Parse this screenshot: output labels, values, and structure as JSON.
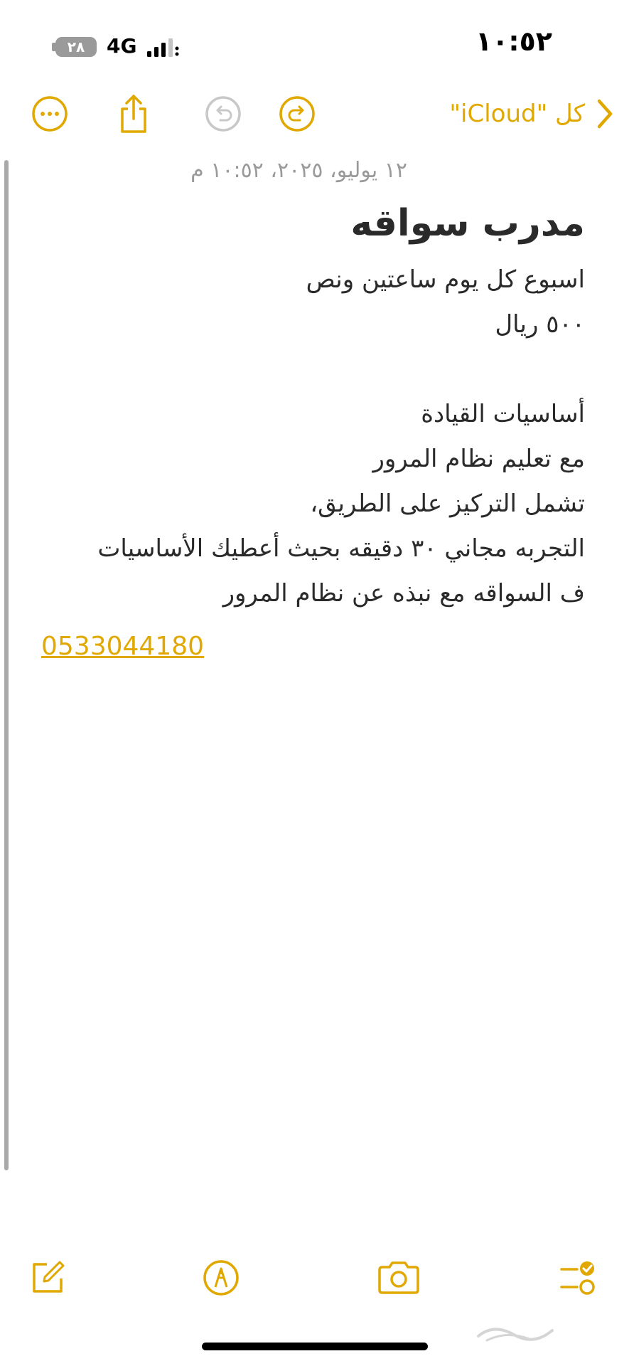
{
  "status_bar": {
    "time": "١٠:٥٢",
    "network": "4G",
    "battery": "٢٨"
  },
  "toolbar": {
    "back_label": "كل \"iCloud\"",
    "icons": {
      "more": "ellipsis-circle-icon",
      "share": "share-icon",
      "undo": "undo-icon",
      "redo": "redo-icon",
      "back": "chevron-right-icon"
    }
  },
  "note": {
    "date": "١٢ يوليو، ٢٠٢٥، ١٠:٥٢ م",
    "title": "مدرب سواقه",
    "lines": [
      "اسبوع كل يوم ساعتين ونص",
      "٥٠٠ ريال",
      "",
      "أساسيات القيادة",
      "مع تعليم نظام المرور",
      "تشمل التركيز على الطريق،",
      "التجربه مجاني ٣٠ دقيقه بحيث أعطيك الأساسيات",
      "ف السواقه مع نبذه عن نظام المرور"
    ],
    "phone": "0533044180"
  },
  "bottom_toolbar": {
    "icons": {
      "checklist": "checklist-icon",
      "camera": "camera-icon",
      "markup": "markup-pen-icon",
      "compose": "compose-icon"
    }
  },
  "colors": {
    "accent": "#e0a800",
    "text": "#2a2a2a",
    "secondary": "#9a9a9a"
  }
}
